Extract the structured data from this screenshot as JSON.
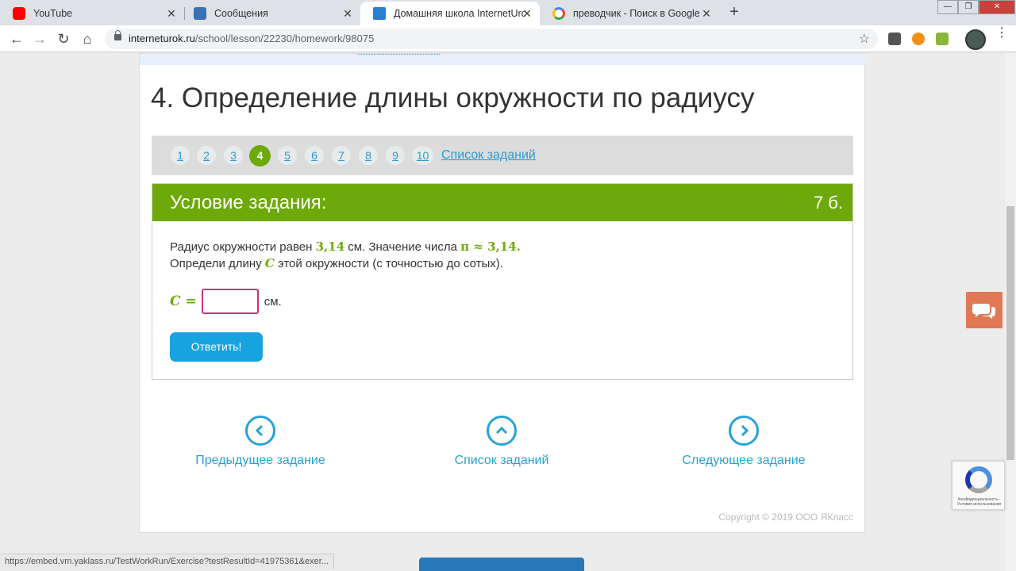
{
  "browser": {
    "tabs": [
      {
        "label": "YouTube",
        "icon": "youtube-icon"
      },
      {
        "label": "Сообщения",
        "icon": "messages-icon"
      },
      {
        "label": "Домашняя школа InternetUrok.r",
        "icon": "internetur-icon"
      },
      {
        "label": "преводчик - Поиск в Google",
        "icon": "google-icon"
      }
    ],
    "url_host": "interneturok.ru",
    "url_path": "/school/lesson/22230/homework/98075",
    "status_url": "https://embed.vm.yaklass.ru/TestWorkRun/Exercise?testResultId=41975361&exer..."
  },
  "page": {
    "title": "4. Определение длины окружности по радиусу",
    "pager": {
      "pages": [
        "1",
        "2",
        "3",
        "4",
        "5",
        "6",
        "7",
        "8",
        "9",
        "10"
      ],
      "current": "4",
      "all_link": "Список заданий"
    },
    "task": {
      "heading": "Условие задания:",
      "points": "7 б.",
      "line1_a": "Радиус окружности равен ",
      "radius": "3,14",
      "line1_b": " см. Значение числа ",
      "pi_expr": "π ≈ 3,14.",
      "line2_a": "Определи длину ",
      "c_symbol": "C",
      "line2_b": " этой окружности (с точностью до сотых).",
      "answer_label": "C =",
      "answer_value": "",
      "unit": "см.",
      "submit_label": "Ответить!"
    },
    "nav": {
      "prev": "Предыдущее задание",
      "list": "Список заданий",
      "next": "Следующее задание"
    },
    "copyright": "Copyright © 2019 ООО ЯКласс",
    "recaptcha_text": "Конфиденциальность - Условия использования"
  },
  "colors": {
    "accent_green": "#6ea90c",
    "link_blue": "#2a9ad3",
    "button_blue": "#17a3e0",
    "input_border": "#c8347c",
    "chat_orange": "#e07856"
  }
}
